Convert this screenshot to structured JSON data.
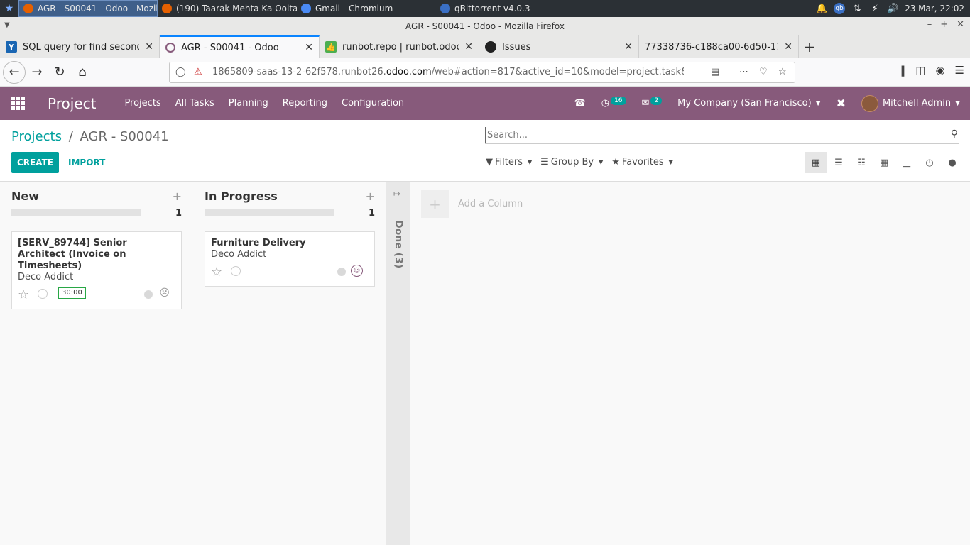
{
  "taskbar": {
    "tasks": [
      {
        "label": "AGR - S00041 - Odoo - Mozill...",
        "icon": "firefox-icon",
        "active": true
      },
      {
        "label": "(190) Taarak Mehta Ka Oolta...",
        "icon": "firefox-icon",
        "active": false
      },
      {
        "label": "Gmail - Chromium",
        "icon": "chromium-icon",
        "active": false
      },
      {
        "label": "qBittorrent v4.0.3",
        "icon": "qbittorrent-icon",
        "active": false
      }
    ],
    "clock": "23 Mar, 22:02"
  },
  "window": {
    "title": "AGR - S00041 - Odoo - Mozilla Firefox"
  },
  "tabs": [
    {
      "label": "SQL query for find second hig",
      "favicon": "Y",
      "color": "#1a66b3"
    },
    {
      "label": "AGR - S00041 - Odoo",
      "favicon": "o",
      "color": "#875a7b"
    },
    {
      "label": "runbot.repo | runbot.odoo.c",
      "favicon": "+",
      "color": "#4caf50"
    },
    {
      "label": "Issues",
      "favicon": "gh",
      "color": "#222222"
    },
    {
      "label": "77338736-c188ca00-6d50-11ea-9",
      "favicon": "",
      "color": "#e8e8e7"
    }
  ],
  "url": {
    "prefix": "1865809-saas-13-2-62f578.runbot26.",
    "domain": "odoo.com",
    "path": "/web#action=817&active_id=10&model=project.task&view_type=kanban"
  },
  "odoo_nav": {
    "brand": "Project",
    "menus": [
      "Projects",
      "All Tasks",
      "Planning",
      "Reporting",
      "Configuration"
    ],
    "activity_count": "16",
    "message_count": "2",
    "company": "My Company (San Francisco)",
    "user": "Mitchell Admin"
  },
  "control_panel": {
    "breadcrumb_parent": "Projects",
    "breadcrumb_sep": "/",
    "breadcrumb_current": "AGR - S00041",
    "create_label": "CREATE",
    "import_label": "IMPORT",
    "search_placeholder": "Search...",
    "filters_label": "Filters",
    "groupby_label": "Group By",
    "favorites_label": "Favorites"
  },
  "kanban": {
    "columns": [
      {
        "title": "New",
        "count": "1",
        "card": {
          "title": "[SERV_89744] Senior Architect (Invoice on Timesheets)",
          "partner": "Deco Addict",
          "tag": "30:00"
        }
      },
      {
        "title": "In Progress",
        "count": "1",
        "card": {
          "title": "Furniture Delivery",
          "partner": "Deco Addict"
        }
      }
    ],
    "folded_column": "Done (3)",
    "add_column_label": "Add a Column"
  },
  "colors": {
    "brand": "#875a7b",
    "accent": "#00a09d"
  }
}
